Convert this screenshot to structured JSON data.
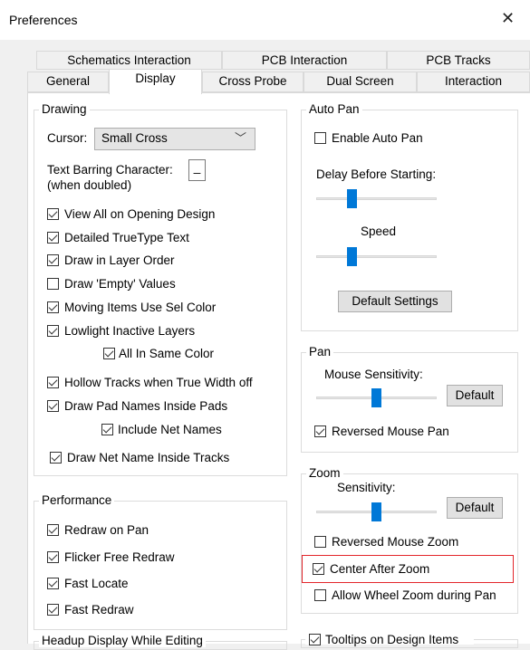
{
  "window": {
    "title": "Preferences"
  },
  "tabs": {
    "row1": [
      "Schematics Interaction",
      "PCB Interaction",
      "PCB Tracks"
    ],
    "row2": [
      "General",
      "Display",
      "Cross Probe",
      "Dual Screen",
      "Interaction"
    ],
    "active": "Display"
  },
  "drawing": {
    "label": "Drawing",
    "cursor_label": "Cursor:",
    "cursor_value": "Small Cross",
    "text_barring_label": "Text Barring Character:",
    "text_barring_sub": "(when doubled)",
    "text_barring_value": "_",
    "options": [
      {
        "label": "View All on Opening Design",
        "checked": true
      },
      {
        "label": "Detailed TrueType Text",
        "checked": true
      },
      {
        "label": "Draw in Layer Order",
        "checked": true
      },
      {
        "label": "Draw 'Empty' Values",
        "checked": false
      },
      {
        "label": "Moving Items Use Sel Color",
        "checked": true
      },
      {
        "label": "Lowlight Inactive Layers",
        "checked": true
      },
      {
        "label": "All In Same Color",
        "checked": true
      },
      {
        "label": "Hollow Tracks when True Width off",
        "checked": true
      },
      {
        "label": "Draw Pad Names Inside Pads",
        "checked": true
      },
      {
        "label": "Include Net Names",
        "checked": true
      },
      {
        "label": "Draw Net Name Inside Tracks",
        "checked": true
      }
    ]
  },
  "performance": {
    "label": "Performance",
    "options": [
      {
        "label": "Redraw on Pan",
        "checked": true
      },
      {
        "label": "Flicker Free Redraw",
        "checked": true
      },
      {
        "label": "Fast Locate",
        "checked": true
      },
      {
        "label": "Fast Redraw",
        "checked": true
      }
    ]
  },
  "headup": {
    "label": "Headup Display While Editing"
  },
  "auto_pan": {
    "label": "Auto Pan",
    "enable_label": "Enable Auto Pan",
    "enable_checked": false,
    "delay_label": "Delay Before Starting:",
    "speed_label": "Speed",
    "default_settings_label": "Default Settings"
  },
  "pan": {
    "label": "Pan",
    "sensitivity_label": "Mouse Sensitivity:",
    "default_label": "Default",
    "reversed_label": "Reversed Mouse Pan",
    "reversed_checked": true
  },
  "zoom": {
    "label": "Zoom",
    "sensitivity_label": "Sensitivity:",
    "default_label": "Default",
    "reversed_label": "Reversed Mouse Zoom",
    "reversed_checked": false,
    "center_label": "Center After Zoom",
    "center_checked": true,
    "wheel_label": "Allow Wheel Zoom during Pan",
    "wheel_checked": false
  },
  "tooltips": {
    "label": "Tooltips on Design Items",
    "checked": true
  }
}
